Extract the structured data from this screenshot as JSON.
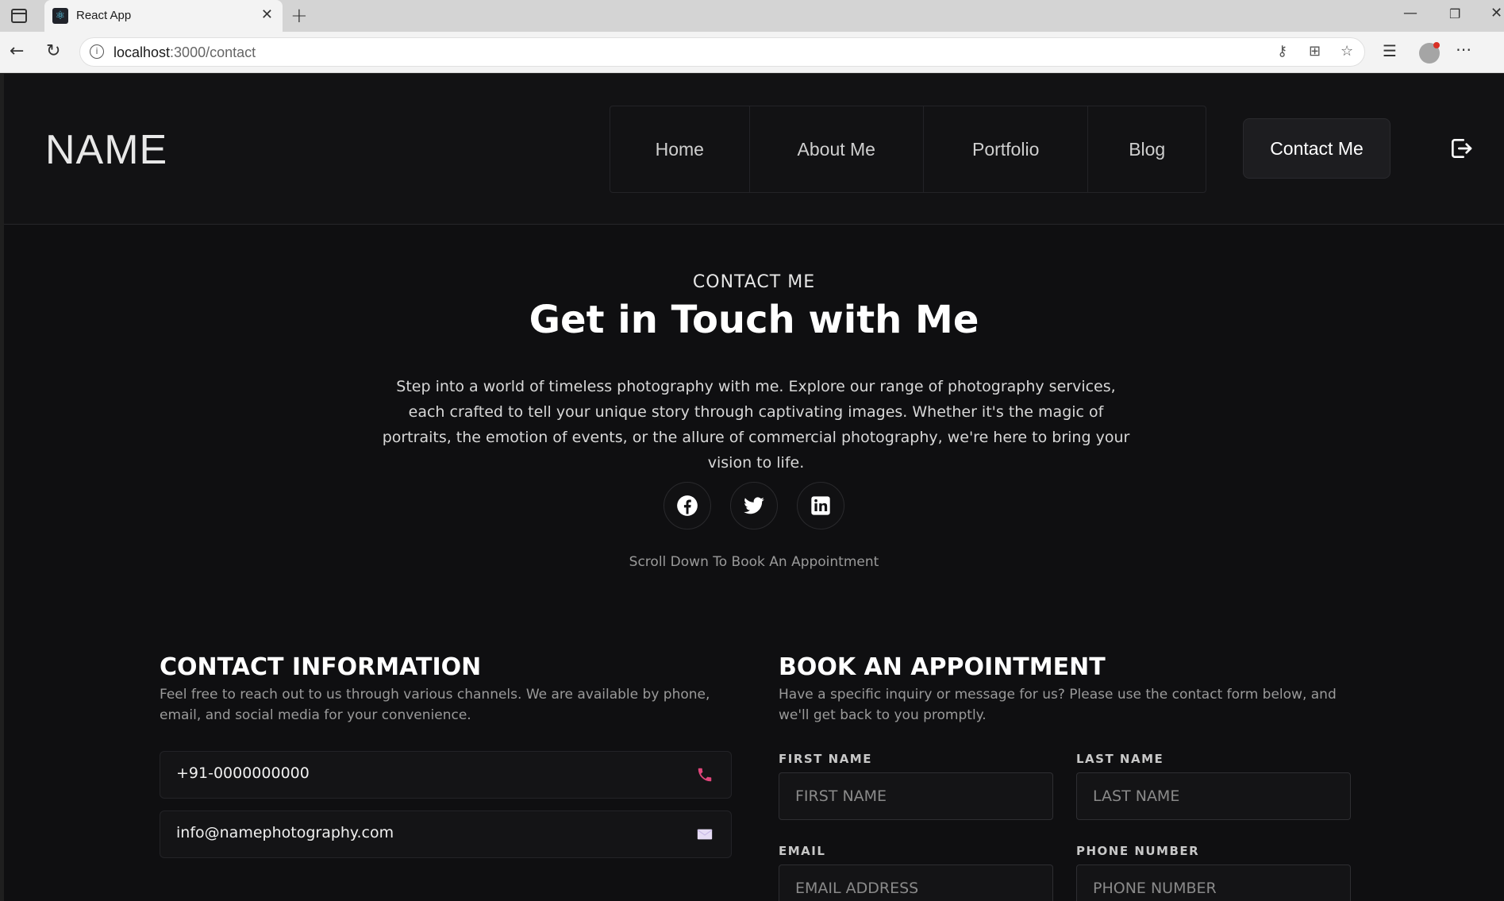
{
  "browser": {
    "tab_title": "React App",
    "url_host": "localhost",
    "url_path": ":3000/contact"
  },
  "header": {
    "logo": "NAME",
    "nav": [
      "Home",
      "About Me",
      "Portfolio",
      "Blog"
    ],
    "cta": "Contact Me"
  },
  "hero": {
    "eyebrow": "CONTACT ME",
    "title": "Get in Touch with Me",
    "description": "Step into a world of timeless photography with me. Explore our range of photography services, each crafted to tell your unique story through captivating images. Whether it's the magic of portraits, the emotion of events, or the allure of commercial photography, we're here to bring your vision to life.",
    "socials": [
      "facebook-icon",
      "twitter-icon",
      "linkedin-icon"
    ],
    "scroll_hint": "Scroll Down To Book An Appointment"
  },
  "contact_info": {
    "title": "CONTACT INFORMATION",
    "description": "Feel free to reach out to us through various channels. We are available by phone, email, and social media for your convenience.",
    "phone": "+91-0000000000",
    "email": "info@namephotography.com",
    "phone_icon_color": "#e0457b",
    "mail_icon_color": "#e6dcf5"
  },
  "booking": {
    "title": "BOOK AN APPOINTMENT",
    "description": "Have a specific inquiry or message for us? Please use the contact form below, and we'll get back to you promptly.",
    "first_name_label": "FIRST NAME",
    "first_name_placeholder": "FIRST NAME",
    "last_name_label": "LAST NAME",
    "last_name_placeholder": "LAST NAME",
    "email_label": "EMAIL",
    "email_placeholder": "EMAIL ADDRESS",
    "phone_label": "PHONE NUMBER",
    "phone_placeholder": "PHONE NUMBER"
  }
}
